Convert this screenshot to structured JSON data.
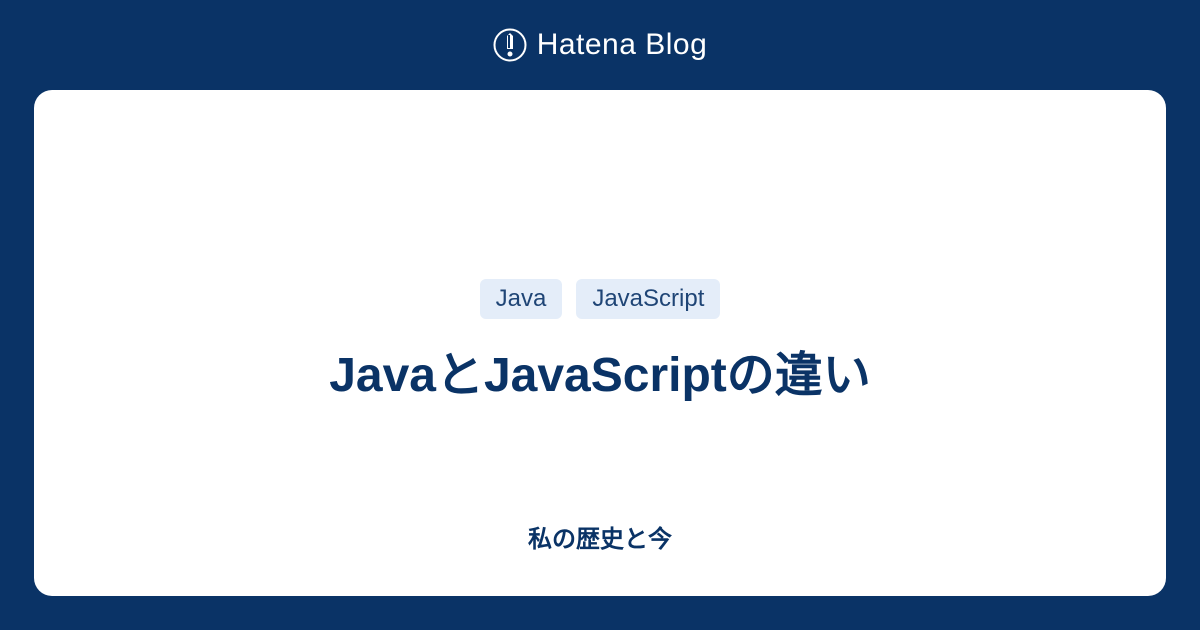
{
  "header": {
    "brand": "Hatena Blog"
  },
  "card": {
    "tags": [
      {
        "label": "Java"
      },
      {
        "label": "JavaScript"
      }
    ],
    "title": "JavaとJavaScriptの違い",
    "blog_name": "私の歴史と今"
  }
}
